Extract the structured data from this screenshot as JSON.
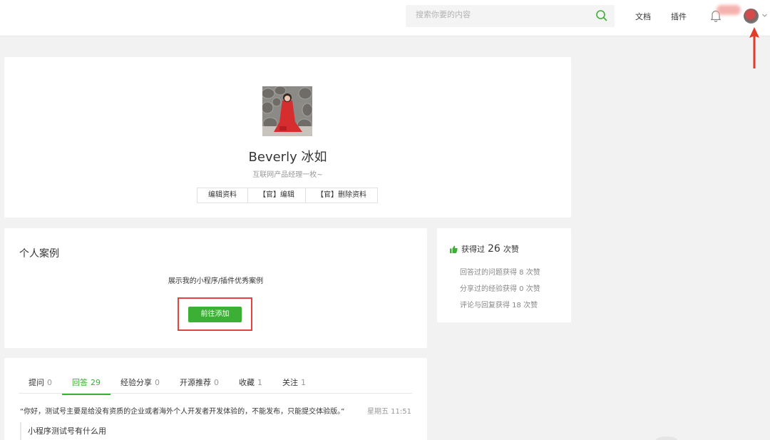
{
  "header": {
    "search_placeholder": "搜索你要的内容",
    "nav": [
      {
        "label": "文档"
      },
      {
        "label": "插件"
      }
    ],
    "accent_color": "#3cb034"
  },
  "profile": {
    "name": "Beverly 冰如",
    "bio": "互联网产品经理一枚~",
    "buttons": [
      {
        "label": "编辑资料"
      },
      {
        "label": "【官】编辑"
      },
      {
        "label": "【官】删除资料"
      }
    ]
  },
  "cases": {
    "title": "个人案例",
    "description": "展示我的小程序/插件优秀案例",
    "add_button": "前往添加",
    "button_color": "#3cb034",
    "highlight_color": "#e64340"
  },
  "likes": {
    "prefix": "获得过",
    "count": "26",
    "suffix": "次赞",
    "lines": [
      "回答过的问题获得 8 次赞",
      "分享过的经验获得 0 次赞",
      "评论与回复获得 18 次赞"
    ]
  },
  "activity": {
    "tabs": [
      {
        "label": "提问",
        "count": "0"
      },
      {
        "label": "回答",
        "count": "29",
        "active": true
      },
      {
        "label": "经验分享",
        "count": "0"
      },
      {
        "label": "开源推荐",
        "count": "0"
      },
      {
        "label": "收藏",
        "count": "1"
      },
      {
        "label": "关注",
        "count": "1"
      }
    ],
    "latest_answer": {
      "text": "“你好，测试号主要是给没有资质的企业或者海外个人开发者开发体验的，不能发布，只能提交体验版。”",
      "time": "星期五 11:51",
      "question": "小程序测试号有什么用"
    }
  }
}
